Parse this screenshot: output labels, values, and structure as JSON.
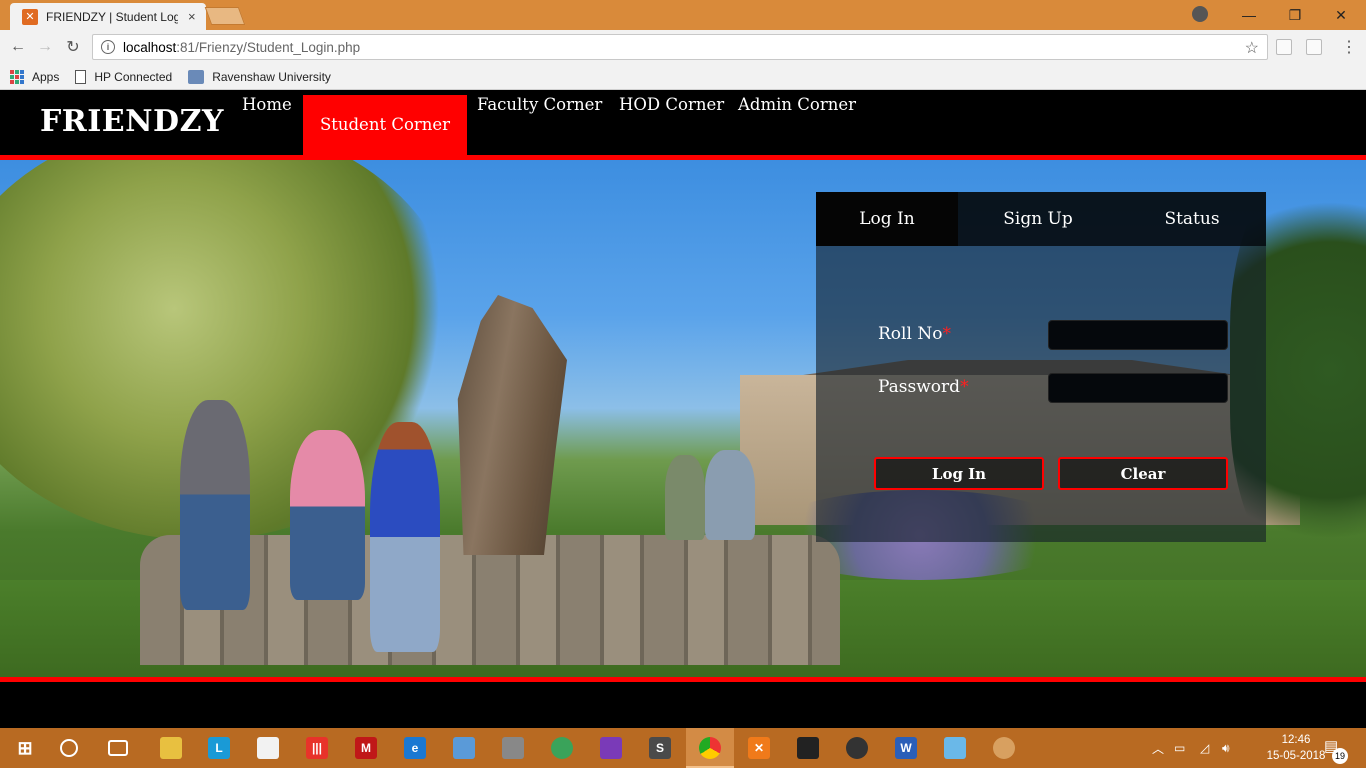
{
  "browser": {
    "tab_title": "FRIENDZY | Student Login",
    "tab_close": "×",
    "url_host": "localhost",
    "url_rest": ":81/Frienzy/Student_Login.php",
    "window_controls": {
      "minimize": "—",
      "restore": "❐",
      "close": "✕"
    },
    "nav": {
      "back": "←",
      "forward": "→",
      "reload": "↻"
    },
    "star": "☆",
    "bookmarks": [
      {
        "label": "Apps",
        "icon": "apps-grid-icon"
      },
      {
        "label": "HP Connected",
        "icon": "page-icon"
      },
      {
        "label": "Ravenshaw University",
        "icon": "university-icon"
      }
    ]
  },
  "site": {
    "logo": "FRIENDZY",
    "nav": {
      "home": "Home",
      "student": "Student Corner",
      "faculty": "Faculty Corner",
      "hod": "HOD Corner",
      "admin": "Admin Corner"
    },
    "accent_color": "#ff0000"
  },
  "login_panel": {
    "tabs": {
      "login": "Log In",
      "signup": "Sign Up",
      "status": "Status"
    },
    "fields": {
      "roll_label": "Roll No",
      "password_label": "Password",
      "required_mark": "*",
      "roll_value": "",
      "password_value": ""
    },
    "buttons": {
      "login": "Log In",
      "clear": "Clear"
    }
  },
  "taskbar": {
    "clock_time": "12:46",
    "clock_date": "15-05-2018",
    "notification_count": "19",
    "pinned_apps": [
      "file-explorer-icon",
      "l-app-icon",
      "store-icon",
      "app-red-icon",
      "mcafee-icon",
      "edge-icon",
      "box-icon",
      "tools-icon",
      "atom-icon",
      "visual-studio-icon",
      "sublime-icon",
      "chrome-icon",
      "xampp-icon",
      "terminal-icon",
      "wpm-icon",
      "word-icon",
      "notes-icon",
      "paint-icon"
    ]
  }
}
